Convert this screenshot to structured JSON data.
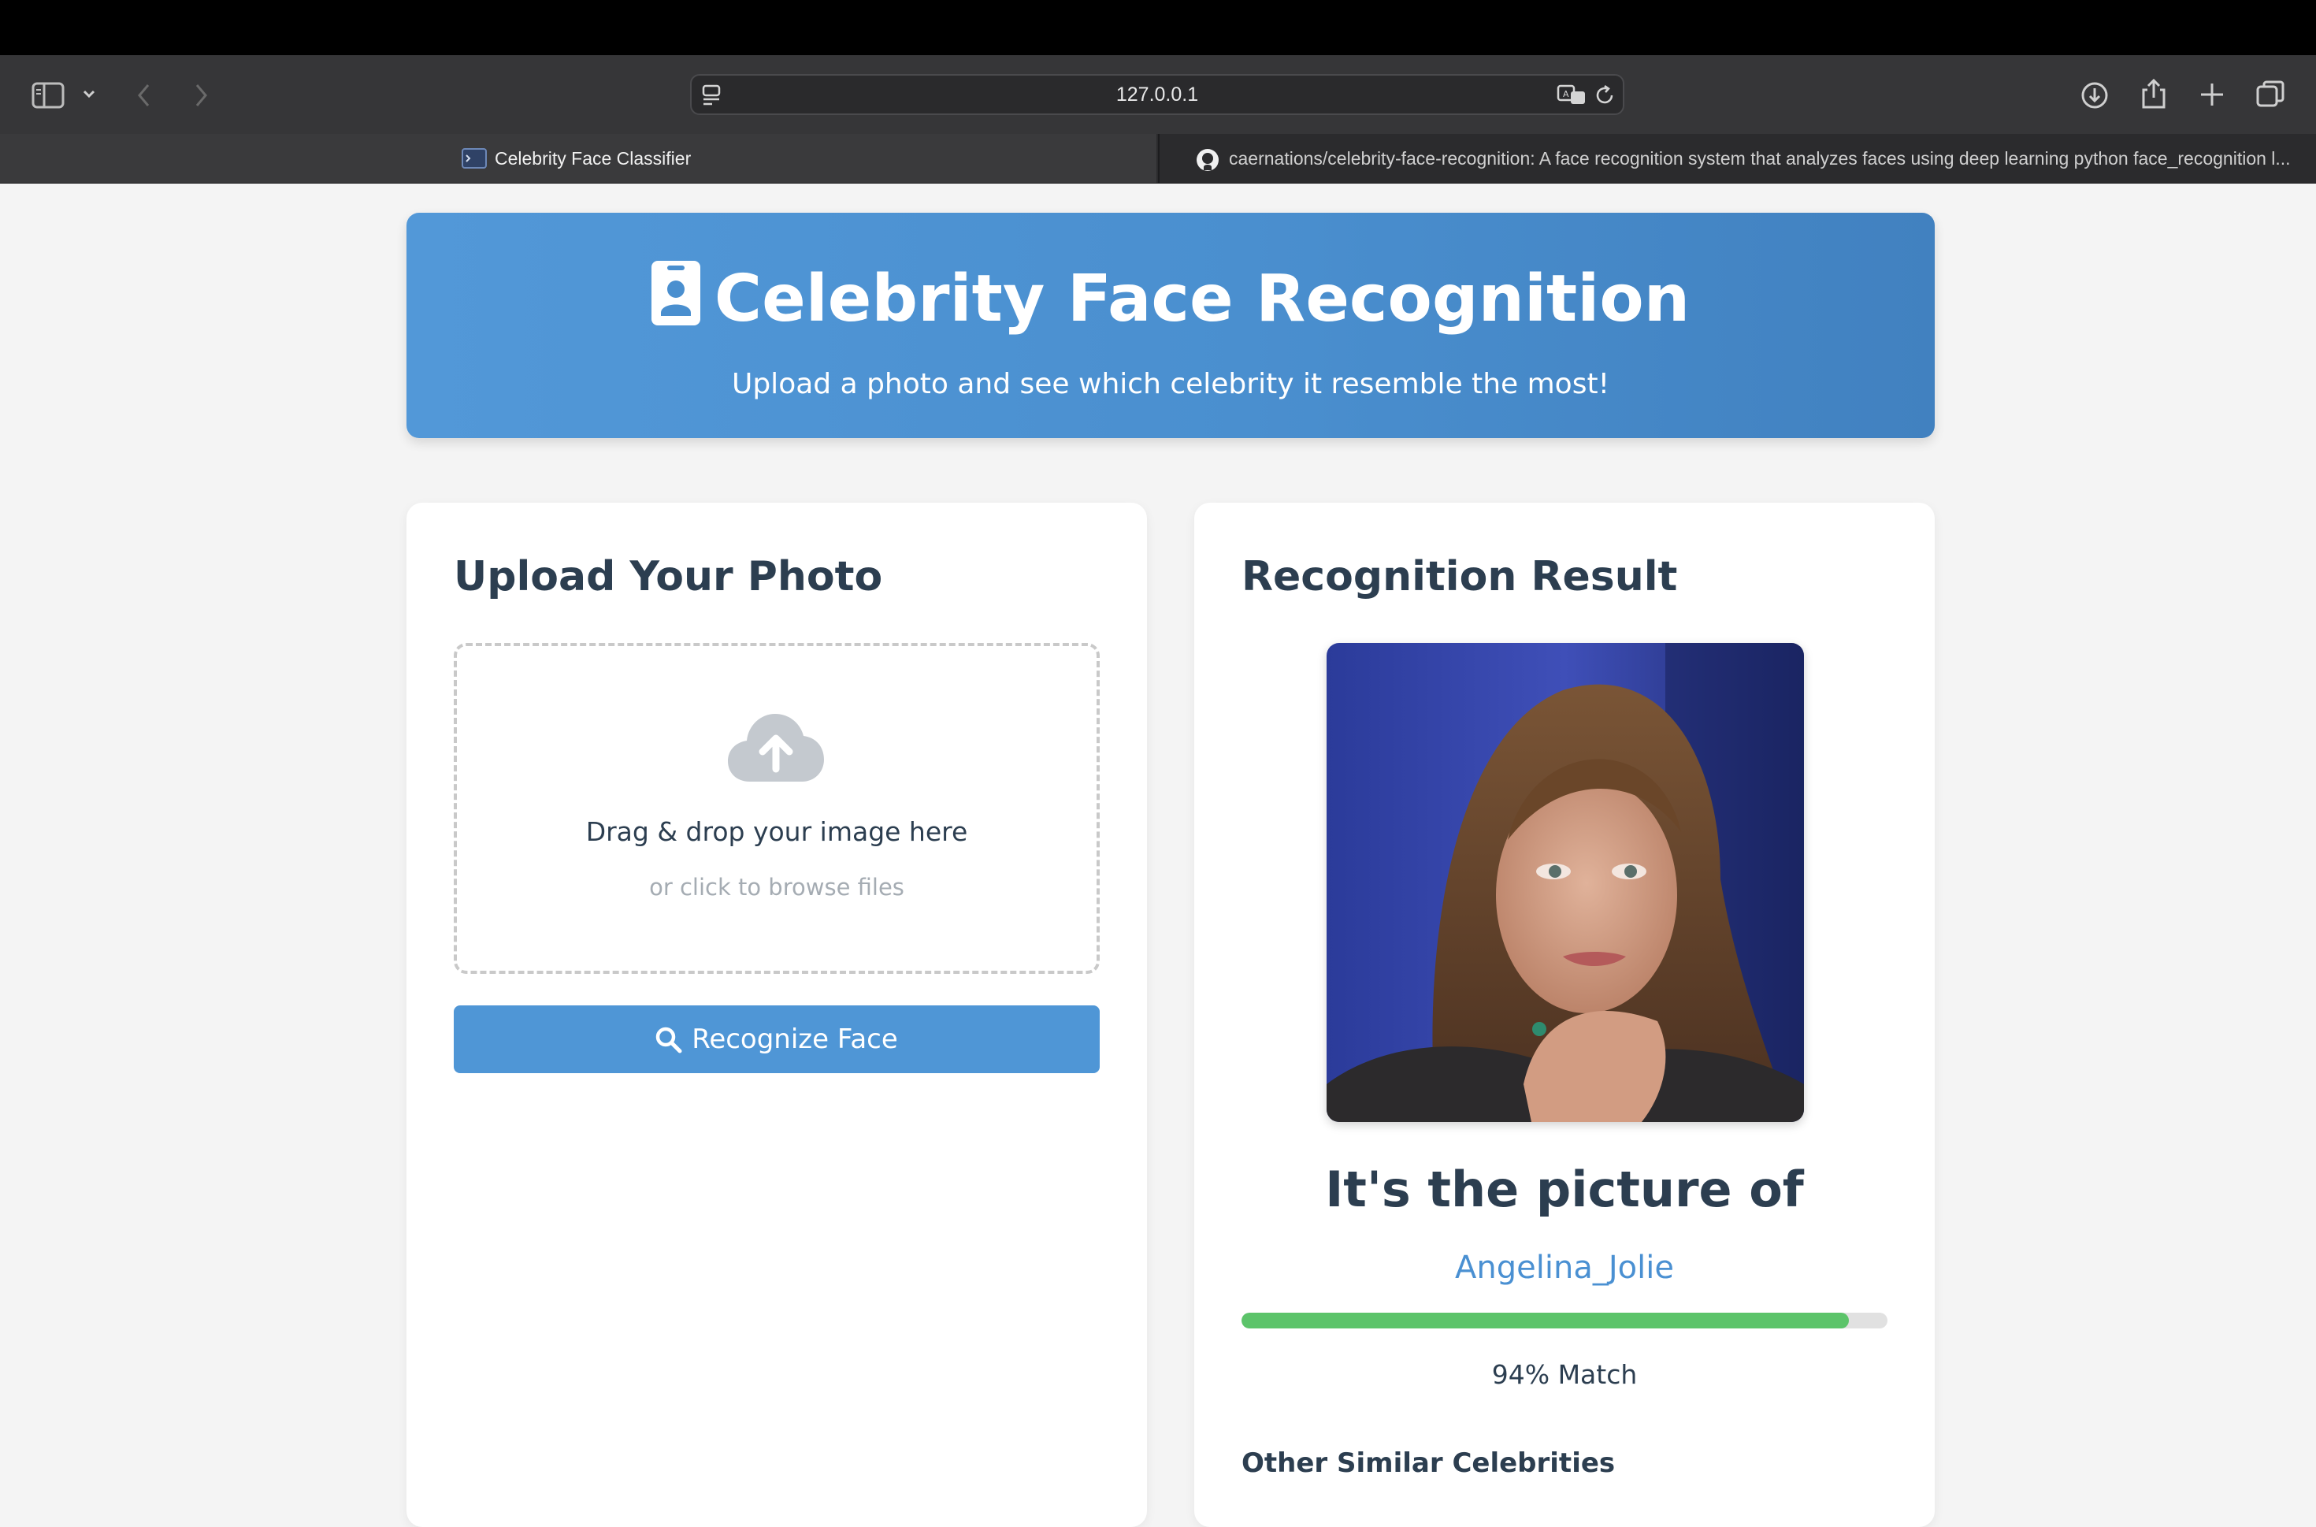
{
  "browser": {
    "address": "127.0.0.1",
    "tabs": [
      {
        "label": "Celebrity Face Classifier",
        "active": true
      },
      {
        "label": "caernations/celebrity-face-recognition: A face recognition system that analyzes faces using deep learning python face_recognition l...",
        "active": false
      }
    ]
  },
  "header": {
    "title": "Celebrity Face Recognition",
    "subtitle": "Upload a photo and see which celebrity it resemble the most!"
  },
  "upload": {
    "title": "Upload Your Photo",
    "drop_main": "Drag & drop your image here",
    "drop_sub": "or click to browse files",
    "button_label": "Recognize Face"
  },
  "result": {
    "title": "Recognition Result",
    "heading": "It's the picture of",
    "name": "Angelina_Jolie",
    "match_fraction": 0.94,
    "match_text": "94% Match",
    "similar_heading": "Other Similar Celebrities"
  },
  "colors": {
    "accent": "#4f96d6",
    "header_gradient_start": "#5298d8",
    "header_gradient_end": "#4181c0",
    "progress": "#5cc46a",
    "name": "#4a90d2"
  }
}
